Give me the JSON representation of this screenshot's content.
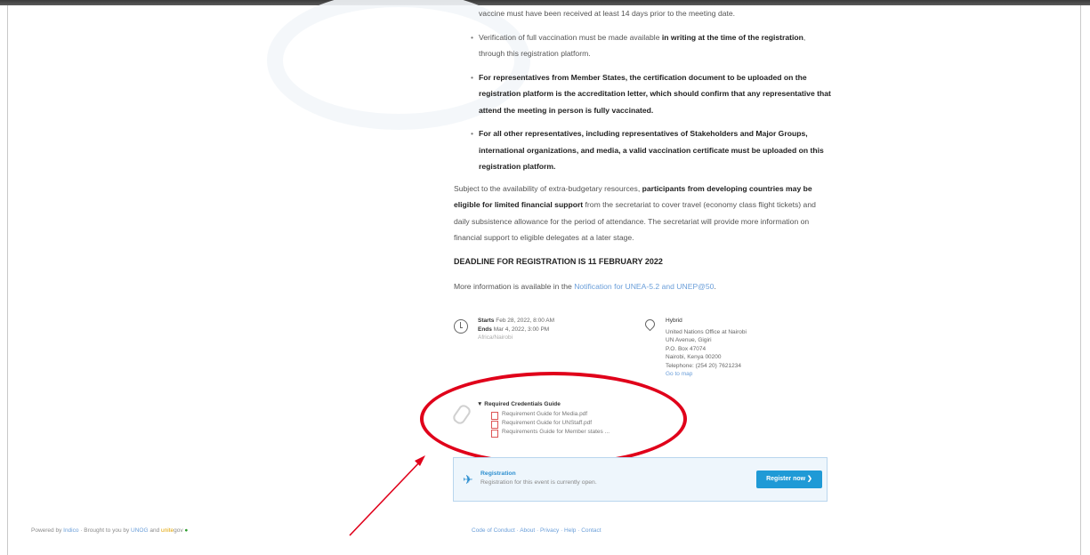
{
  "content": {
    "line0": "vaccine must have been received at least 14 days prior to the meeting date.",
    "bullet1_a": "Verification of full vaccination must be made available ",
    "bullet1_b": "in writing at the time of the registration",
    "bullet1_c": ", through this registration platform.",
    "bullet2": "For representatives from Member States, the certification document to be uploaded on the registration platform is the accreditation letter, which should confirm that any representative that attend the meeting in person is fully vaccinated.",
    "bullet3": "For all other representatives, including representatives of Stakeholders and Major Groups, international organizations, and media, a valid vaccination certificate must be uploaded on this registration platform.",
    "para_a": "Subject to the availability of extra-budgetary resources, ",
    "para_b": "participants from developing countries may be eligible for limited financial support",
    "para_c": " from the secretariat to cover travel (economy class flight tickets) and daily subsistence allowance for the period of attendance. The secretariat will provide more information on financial support to eligible delegates at a later stage.",
    "deadline": "DEADLINE FOR REGISTRATION IS 11 FEBRUARY 2022",
    "more_a": "More information is available in the ",
    "more_link": "Notification for UNEA-5.2 and UNEP@50",
    "more_c": "."
  },
  "meta": {
    "starts_label": "Starts",
    "starts_value": "Feb 28, 2022, 8:00 AM",
    "ends_label": "Ends",
    "ends_value": "Mar 4, 2022, 3:00 PM",
    "timezone": "Africa/Nairobi",
    "venue_title": "Hybrid",
    "venue_lines": [
      "United Nations Office at Nairobi",
      "UN Avenue, Gigiri",
      "P.O. Box 47074",
      "Nairobi, Kenya 00200",
      "Telephone: (254 20) 7621234"
    ],
    "map_link": "Go to map"
  },
  "docs": {
    "heading": "Required Credentials Guide",
    "items": [
      "Requirement Guide for Media.pdf",
      "Requirement Guide for UNStaff.pdf",
      "Requirements Guide for Member states ..."
    ]
  },
  "registration": {
    "title": "Registration",
    "subtitle": "Registration for this event is currently open.",
    "button": "Register now"
  },
  "footer": {
    "left_a": "Powered by ",
    "left_b": "Indico",
    "left_c": " · Brought to you by ",
    "left_d": "UNOG",
    "left_e": " and ",
    "left_brand": "unite",
    "left_brand2": "gov",
    "links": "Code of Conduct · About · Privacy · Help · Contact"
  },
  "colors": {
    "annotation": "#e0001a",
    "accent": "#1f9ad6"
  }
}
